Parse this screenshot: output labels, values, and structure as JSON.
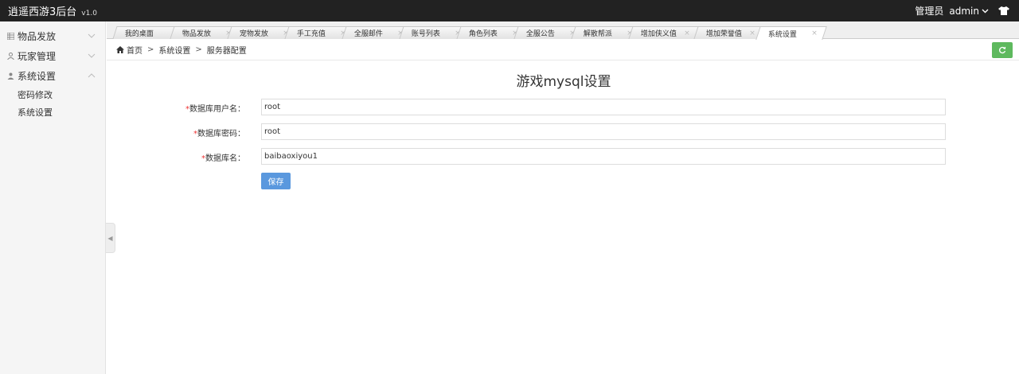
{
  "header": {
    "title": "逍遥西游3后台",
    "version": "v1.0",
    "role": "管理员",
    "user": "admin",
    "icon_user_caret": "chevron-down-icon",
    "icon_skin": "tshirt-icon"
  },
  "sidebar": {
    "items": [
      {
        "label": "物品发放",
        "icon": "grid-icon",
        "expanded": false
      },
      {
        "label": "玩家管理",
        "icon": "user-icon",
        "expanded": false
      },
      {
        "label": "系统设置",
        "icon": "user-icon",
        "expanded": true
      }
    ],
    "subitems": [
      {
        "label": "密码修改"
      },
      {
        "label": "系统设置"
      }
    ]
  },
  "tabs": [
    {
      "label": "我的桌面",
      "closable": false,
      "active": false
    },
    {
      "label": "物品发放",
      "closable": true,
      "active": false
    },
    {
      "label": "宠物发放",
      "closable": true,
      "active": false
    },
    {
      "label": "手工充值",
      "closable": true,
      "active": false
    },
    {
      "label": "全服邮件",
      "closable": true,
      "active": false
    },
    {
      "label": "账号列表",
      "closable": true,
      "active": false
    },
    {
      "label": "角色列表",
      "closable": true,
      "active": false
    },
    {
      "label": "全服公告",
      "closable": true,
      "active": false
    },
    {
      "label": "解散帮派",
      "closable": true,
      "active": false
    },
    {
      "label": "增加侠义值",
      "closable": true,
      "active": false
    },
    {
      "label": "增加荣誉值",
      "closable": true,
      "active": false
    },
    {
      "label": "系统设置",
      "closable": true,
      "active": true
    }
  ],
  "tab_close_glyph": "×",
  "breadcrumb": {
    "home": "首页",
    "separator": ">",
    "level1": "系统设置",
    "level2": "服务器配置"
  },
  "form": {
    "title": "游戏mysql设置",
    "required_mark": "*",
    "fields": [
      {
        "label": "数据库用户名：",
        "value": "root"
      },
      {
        "label": "数据库密码：",
        "value": "root"
      },
      {
        "label": "数据库名：",
        "value": "baibaoxiyou1"
      }
    ],
    "save_label": "保存"
  },
  "colors": {
    "header_bg": "#222222",
    "sidebar_bg": "#f5f5f5",
    "refresh_btn": "#5eb95e",
    "save_btn": "#5a98de",
    "required": "#ee3333"
  }
}
